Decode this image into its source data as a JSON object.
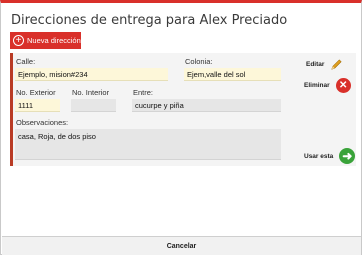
{
  "dialog": {
    "title": "Direcciones de entrega para Alex Preciado",
    "new_button_label": "Nueva dirección",
    "cancel_label": "Cancelar"
  },
  "address": {
    "street_label": "Calle:",
    "street_value": "Ejemplo, mision#234",
    "colonia_label": "Colonia:",
    "colonia_value": "Ejem,valle del sol",
    "ext_label": "No. Exterior",
    "ext_value": "1111",
    "int_label": "No. Interior",
    "int_value": "",
    "between_label": "Entre:",
    "between_value": "cucurpe y piña",
    "notes_label": "Observaciones:",
    "notes_value": "casa,  Roja, de dos piso"
  },
  "actions": {
    "edit_label": "Editar",
    "delete_label": "Eliminar",
    "use_label": "Usar esta"
  },
  "colors": {
    "accent": "#d9302a",
    "field_yellow": "#fdf7d9",
    "use_green": "#3aa33a"
  }
}
